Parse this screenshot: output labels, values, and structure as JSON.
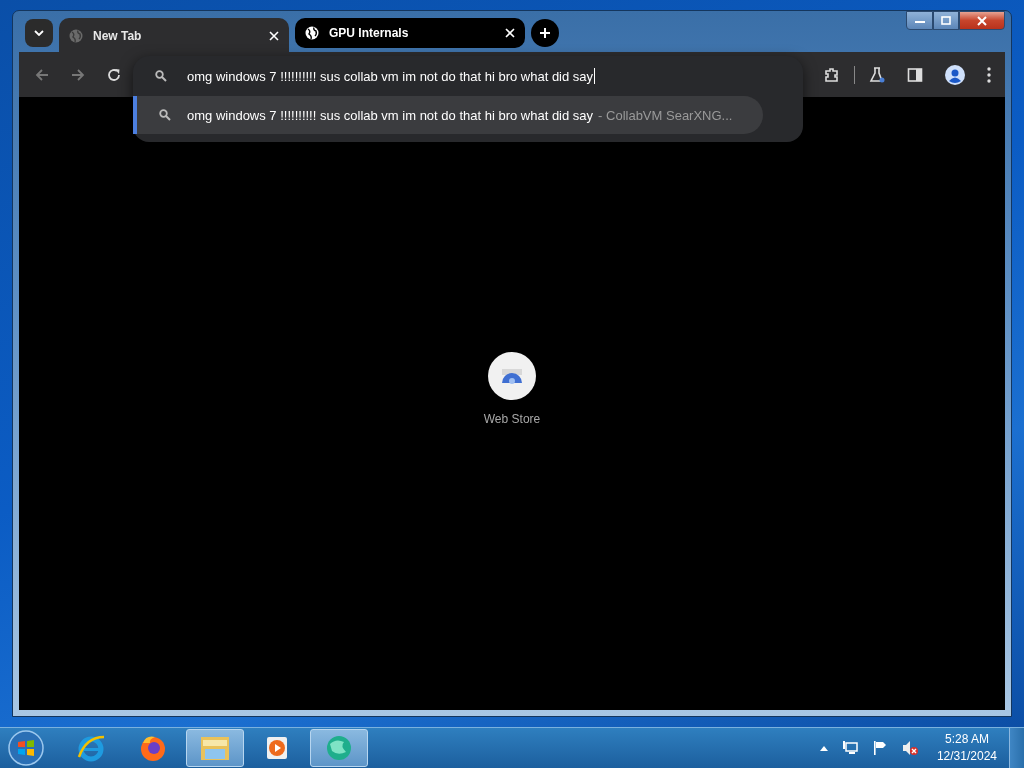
{
  "tabs": [
    {
      "title": "New Tab",
      "selected": true
    },
    {
      "title": "GPU Internals",
      "selected": false
    }
  ],
  "omnibox": {
    "value": "omg windows 7 !!!!!!!!!! sus collab vm im not do that hi bro what did say",
    "suggestions": [
      {
        "text": "omg windows 7 !!!!!!!!!! sus collab vm im not do that hi bro what did say",
        "source": "- CollabVM SearXNG...",
        "selected": true
      }
    ]
  },
  "shortcuts": [
    {
      "label": "Web Store"
    }
  ],
  "taskbar": {
    "items": [
      {
        "kind": "ie",
        "active": false
      },
      {
        "kind": "firefox",
        "active": false
      },
      {
        "kind": "explorer",
        "active": true
      },
      {
        "kind": "media",
        "active": false
      },
      {
        "kind": "globe",
        "active": true
      }
    ]
  },
  "clock": {
    "time": "5:28 AM",
    "date": "12/31/2024"
  }
}
